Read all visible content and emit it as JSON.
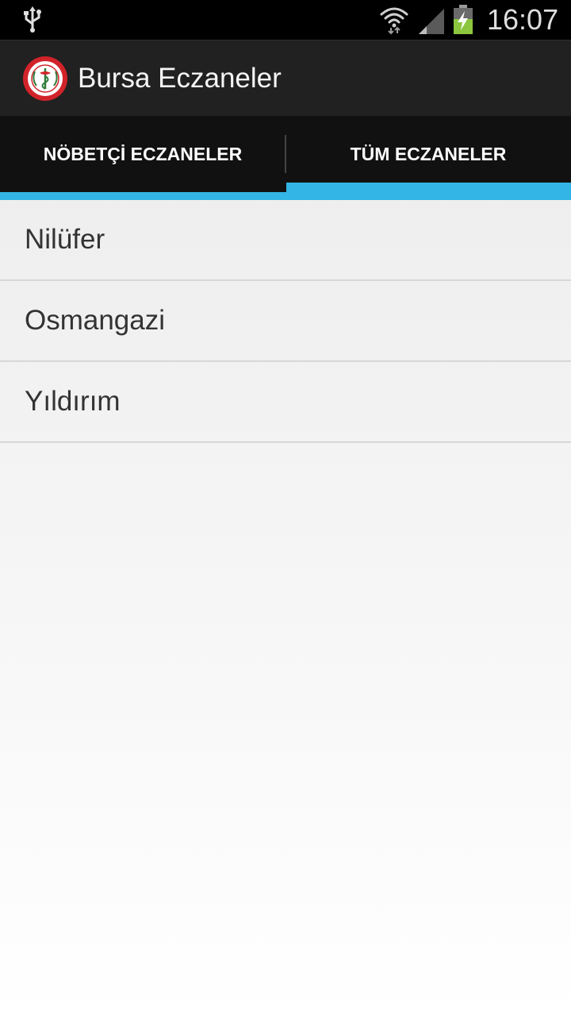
{
  "status_bar": {
    "time": "16:07",
    "icons": [
      "usb-icon",
      "wifi-icon",
      "signal-icon",
      "battery-charging-icon"
    ]
  },
  "app": {
    "title": "Bursa Eczaneler",
    "logo": "bursa-eczacilar-odasi-logo"
  },
  "tabs": [
    {
      "label": "NÖBETÇİ ECZANELER",
      "selected": false
    },
    {
      "label": "TÜM ECZANELER",
      "selected": true
    }
  ],
  "districts": [
    {
      "label": "Nilüfer"
    },
    {
      "label": "Osmangazi"
    },
    {
      "label": "Yıldırım"
    }
  ],
  "colors": {
    "accent": "#33b5e5",
    "action_bar": "#212121",
    "tab_strip": "#111111",
    "logo_red": "#d2232a"
  }
}
